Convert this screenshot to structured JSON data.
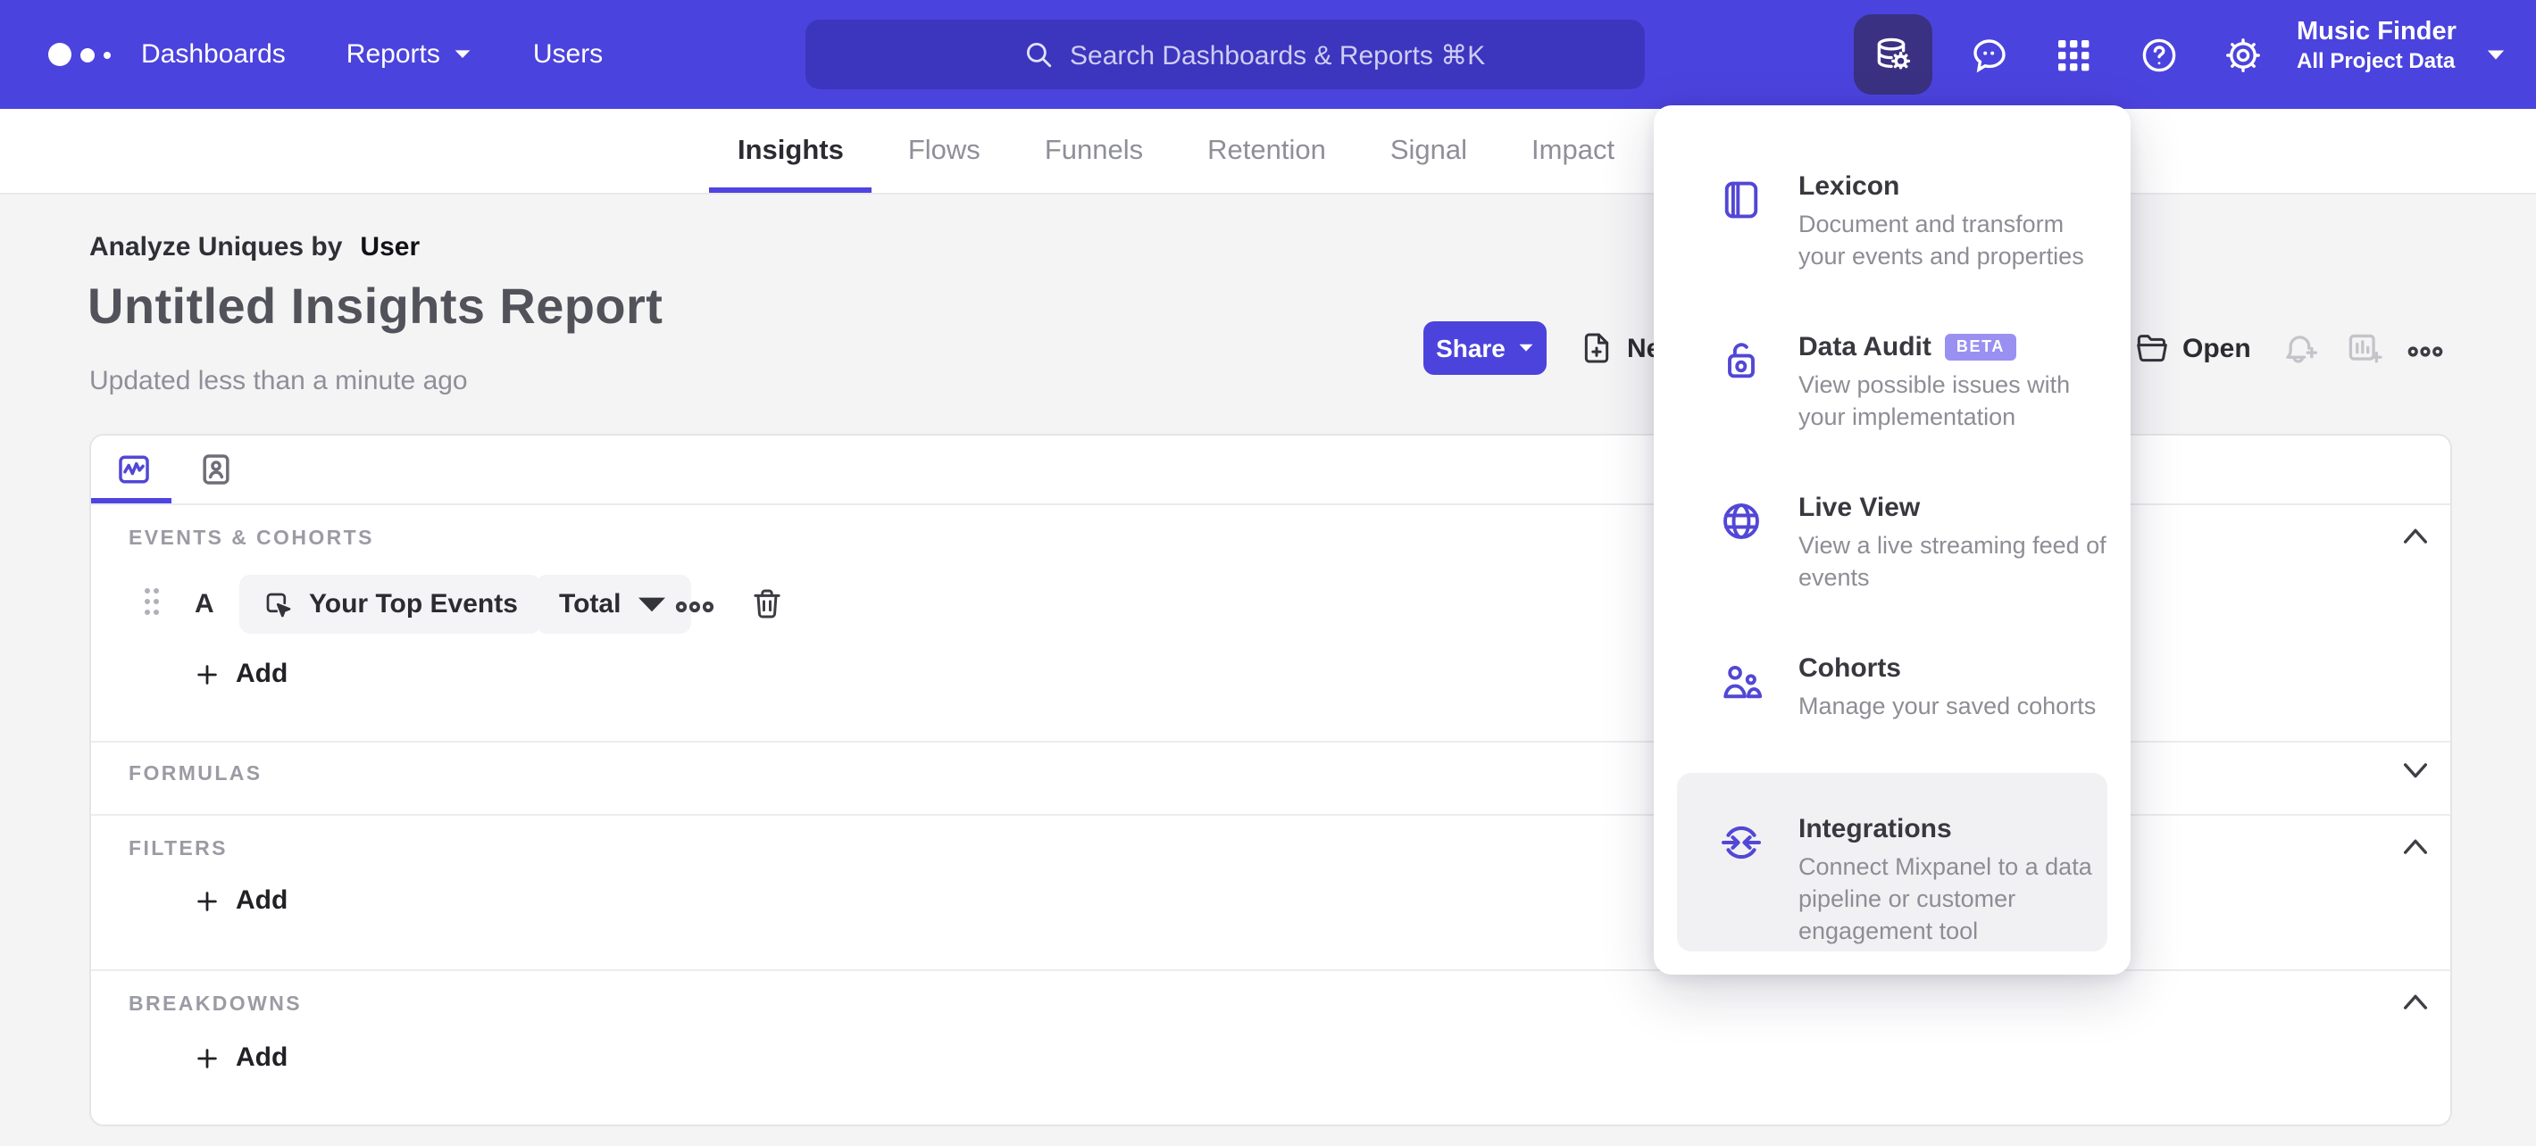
{
  "nav": {
    "items": [
      {
        "label": "Dashboards"
      },
      {
        "label": "Reports"
      },
      {
        "label": "Users"
      }
    ],
    "search_placeholder": "Search Dashboards & Reports ⌘K",
    "project": {
      "name": "Music Finder",
      "scope": "All Project Data"
    }
  },
  "tabs": [
    {
      "label": "Insights",
      "active": true
    },
    {
      "label": "Flows",
      "active": false
    },
    {
      "label": "Funnels",
      "active": false
    },
    {
      "label": "Retention",
      "active": false
    },
    {
      "label": "Signal",
      "active": false
    },
    {
      "label": "Impact",
      "active": false
    }
  ],
  "report": {
    "analyze_label": "Analyze Uniques by",
    "analyze_value": "User",
    "title": "Untitled Insights Report",
    "updated": "Updated less than a minute ago"
  },
  "toolbar": {
    "share_label": "Share",
    "new_label": "New",
    "open_label": "Open"
  },
  "menu": {
    "items": [
      {
        "title": "Lexicon",
        "description": "Document and transform your events and properties"
      },
      {
        "title": "Data Audit",
        "badge": "BETA",
        "description": "View possible issues with your implementation"
      },
      {
        "title": "Live View",
        "description": "View a live streaming feed of events"
      },
      {
        "title": "Cohorts",
        "description": "Manage your saved cohorts"
      },
      {
        "title": "Integrations",
        "description": "Connect Mixpanel to a data pipeline or customer engagement tool",
        "highlighted": true
      }
    ]
  },
  "builder": {
    "sections": [
      {
        "label": "EVENTS & COHORTS",
        "collapsed": false
      },
      {
        "label": "FORMULAS",
        "collapsed": true
      },
      {
        "label": "FILTERS",
        "collapsed": false
      },
      {
        "label": "BREAKDOWNS",
        "collapsed": false
      }
    ],
    "event_row": {
      "letter": "A",
      "event": "Your Top Events",
      "aggregation": "Total"
    },
    "add_label": "Add"
  },
  "colors": {
    "nav_purple": "#4b43dd",
    "accent_purple": "#4f44e0",
    "active_icon_bg": "#3a3182",
    "beta_badge": "#9a90f1",
    "background": "#f4f4f5"
  }
}
